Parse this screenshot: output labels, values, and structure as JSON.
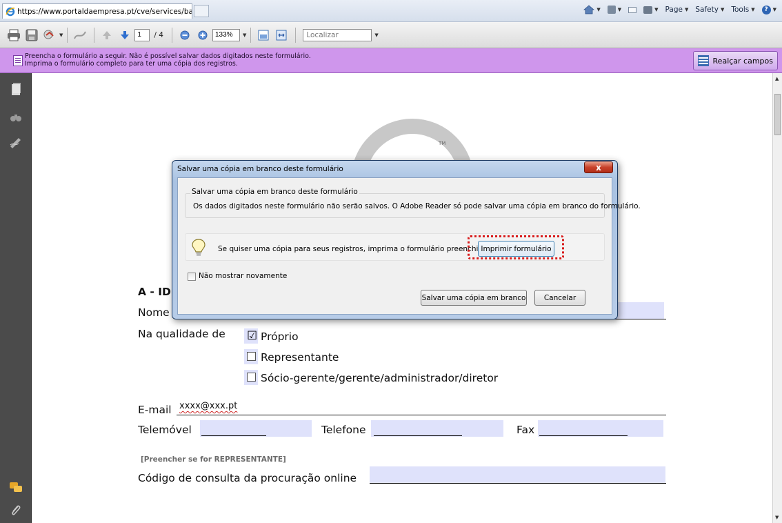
{
  "browser": {
    "tab_title": "https://www.portaldaempresa.pt/cve/services/ba...",
    "commands": [
      "Page",
      "Safety",
      "Tools"
    ]
  },
  "toolbar": {
    "current_page": "1",
    "page_total": "/ 4",
    "zoom": "133%",
    "find_placeholder": "Localizar"
  },
  "forms_bar": {
    "message_line1": "Preencha o formulário a seguir. Não é possível salvar dados digitados neste formulário.",
    "message_line2": "Imprima o formulário completo para ter uma cópia dos registros.",
    "highlight_label": "Realçar campos"
  },
  "document": {
    "logo_tm": "TM",
    "section_title": "A - IDE",
    "name_label": "Nome",
    "quality_label": "Na qualidade de",
    "options": [
      {
        "label": "Próprio",
        "checked": true
      },
      {
        "label": "Representante",
        "checked": false
      },
      {
        "label": "Sócio-gerente/gerente/administrador/diretor",
        "checked": false
      }
    ],
    "email_label": "E-mail",
    "email_value": "xxxx@xxx.pt",
    "mobile_label": "Telemóvel",
    "phone_label": "Telefone",
    "fax_label": "Fax",
    "representative_note": "[Preencher se for REPRESENTANTE]",
    "proxy_code_label": "Código de consulta da procuração online"
  },
  "dialog": {
    "title": "Salvar uma cópia em branco deste formulário",
    "close_label": "x",
    "group_legend": "Salvar uma cópia em branco deste formulário",
    "group_text": "Os dados digitados neste formulário não serão salvos. O Adobe Reader só pode salvar uma cópia em branco do formulário.",
    "hint_text": "Se quiser uma cópia para seus registros, imprima o formulário preenchido.",
    "print_button": "Imprimir formulário",
    "dont_show_label": "Não mostrar novamente",
    "save_button": "Salvar uma cópia em branco",
    "cancel_button": "Cancelar"
  },
  "colors": {
    "forms_bar": "#cf96ec",
    "field_fill": "#dfe2fb",
    "highlight_dash": "#d81c1c"
  }
}
